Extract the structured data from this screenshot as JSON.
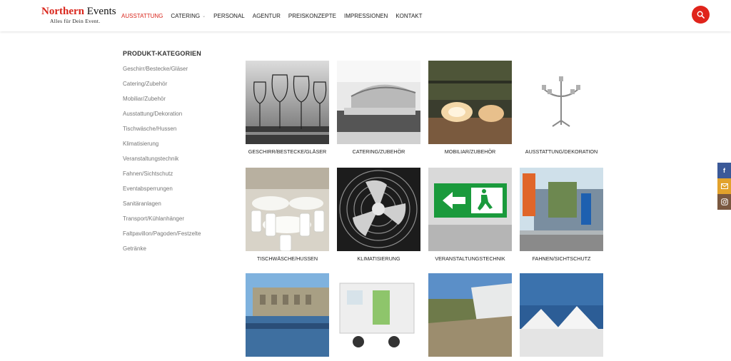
{
  "header": {
    "logo_title": "Northern",
    "logo_title_2": "Events",
    "logo_tagline": "Alles für Dein Event.",
    "nav": [
      {
        "label": "AUSSTATTUNG"
      },
      {
        "label": "CATERING"
      },
      {
        "label": "PERSONAL"
      },
      {
        "label": "AGENTUR"
      },
      {
        "label": "PREISKONZEPTE"
      },
      {
        "label": "IMPRESSIONEN"
      },
      {
        "label": "KONTAKT"
      }
    ],
    "search_icon": "search-icon",
    "accent": "#e0241b"
  },
  "sidebar": {
    "title": "PRODUKT-KATEGORIEN",
    "items": [
      "Geschirr/Bestecke/Gläser",
      "Catering/Zubehör",
      "Mobiliar/Zubehör",
      "Ausstattung/Dekoration",
      "Tischwäsche/Hussen",
      "Klimatisierung",
      "Veranstaltungstechnik",
      "Fahnen/Sichtschutz",
      "Eventabsperrungen",
      "Sanitäranlagen",
      "Transport/Kühlanhänger",
      "Faltpavillon/Pagoden/Festzelte",
      "Getränke"
    ]
  },
  "grid": {
    "tiles": [
      {
        "caption": "GESCHIRR/BESTECKE/GLÄSER"
      },
      {
        "caption": "CATERING/ZUBEHÖR"
      },
      {
        "caption": "MOBILIAR/ZUBEHÖR"
      },
      {
        "caption": "AUSSTATTUNG/DEKORATION"
      },
      {
        "caption": "TISCHWÄSCHE/HUSSEN"
      },
      {
        "caption": "KLIMATISIERUNG"
      },
      {
        "caption": "VERANSTALTUNGSTECHNIK"
      },
      {
        "caption": "FAHNEN/SICHTSCHUTZ"
      },
      {
        "caption": ""
      },
      {
        "caption": ""
      },
      {
        "caption": ""
      },
      {
        "caption": ""
      }
    ]
  },
  "social": {
    "facebook_icon": "facebook-icon",
    "mail_icon": "mail-icon",
    "instagram_icon": "instagram-icon",
    "colors": {
      "facebook": "#3b5998",
      "mail": "#e2a22c",
      "instagram": "#7a5840"
    }
  }
}
